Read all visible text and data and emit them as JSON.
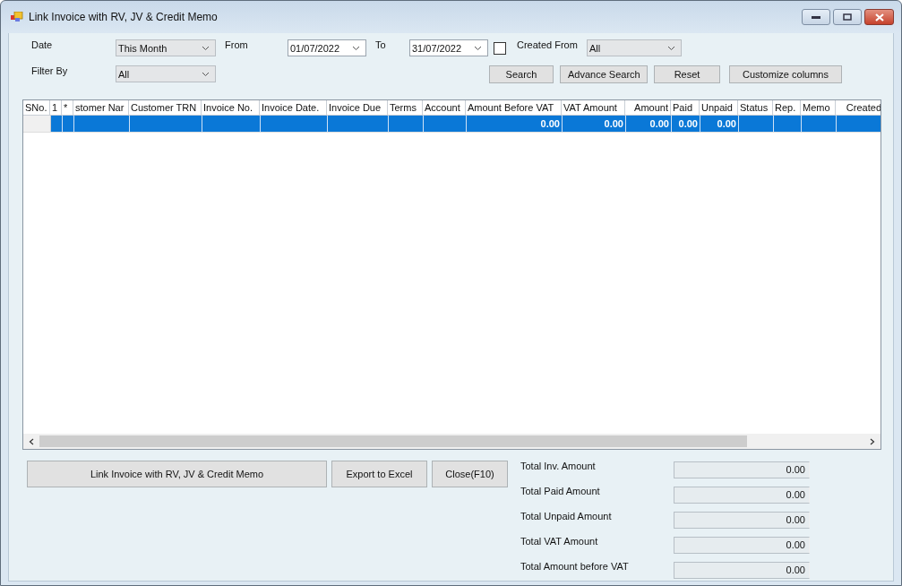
{
  "window": {
    "title": "Link Invoice with RV, JV & Credit Memo"
  },
  "filters": {
    "date_label": "Date",
    "date_value": "This Month",
    "from_label": "From",
    "from_value": "01/07/2022",
    "to_label": "To",
    "to_value": "31/07/2022",
    "created_from_checked": false,
    "created_from_label": "Created From",
    "created_from_value": "All",
    "filter_by_label": "Filter By",
    "filter_by_value": "All"
  },
  "toolbar_buttons": [
    "Search",
    "Advance Search",
    "Reset",
    "Customize columns"
  ],
  "table": {
    "columns": [
      "SNo.",
      "1",
      "*",
      "stomer Nar",
      "Customer TRN",
      "Invoice No.",
      "Invoice Date.",
      "Invoice Due",
      "Terms",
      "Account",
      "Amount Before VAT",
      "VAT Amount",
      "Amount",
      "Paid",
      "Unpaid",
      "Status",
      "Rep.",
      "Memo",
      "Created"
    ],
    "rows": [
      {
        "selected": true,
        "cells": [
          null,
          null,
          null,
          null,
          null,
          null,
          null,
          null,
          null,
          null,
          "0.00",
          "0.00",
          "0.00",
          "0.00",
          "0.00",
          null,
          null,
          null,
          null
        ]
      }
    ]
  },
  "actions": [
    "Link Invoice with RV, JV & Credit Memo",
    "Export to Excel",
    "Close(F10)"
  ],
  "totals": [
    {
      "label": "Total Inv. Amount",
      "value": "0.00"
    },
    {
      "label": "Total Paid Amount",
      "value": "0.00"
    },
    {
      "label": "Total Unpaid Amount",
      "value": "0.00"
    },
    {
      "label": "Total VAT Amount",
      "value": "0.00"
    },
    {
      "label": "Total Amount before VAT",
      "value": "0.00"
    }
  ]
}
